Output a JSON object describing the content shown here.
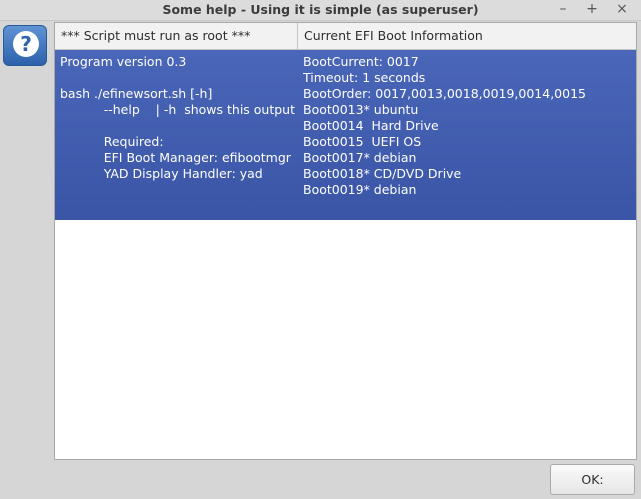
{
  "window": {
    "title": "Some help - Using it is simple (as superuser)",
    "controls": {
      "minimize": "–",
      "maximize": "+",
      "close": "×"
    }
  },
  "icon": {
    "name": "help-question-icon",
    "glyph": "?"
  },
  "table": {
    "columns": [
      "*** Script must run as root ***",
      "Current EFI Boot Information"
    ],
    "rows": [
      {
        "col1": "Program version 0.3\n\nbash ./efinewsort.sh [-h]\n           --help    | -h  shows this output\n\n           Required:\n           EFI Boot Manager: efibootmgr\n           YAD Display Handler: yad",
        "col2": "BootCurrent: 0017\nTimeout: 1 seconds\nBootOrder: 0017,0013,0018,0019,0014,0015\nBoot0013* ubuntu\nBoot0014  Hard Drive\nBoot0015  UEFI OS\nBoot0017* debian\nBoot0018* CD/DVD Drive\nBoot0019* debian"
      }
    ],
    "selection_color": "#3f5cad"
  },
  "buttons": {
    "ok": "OK:"
  }
}
